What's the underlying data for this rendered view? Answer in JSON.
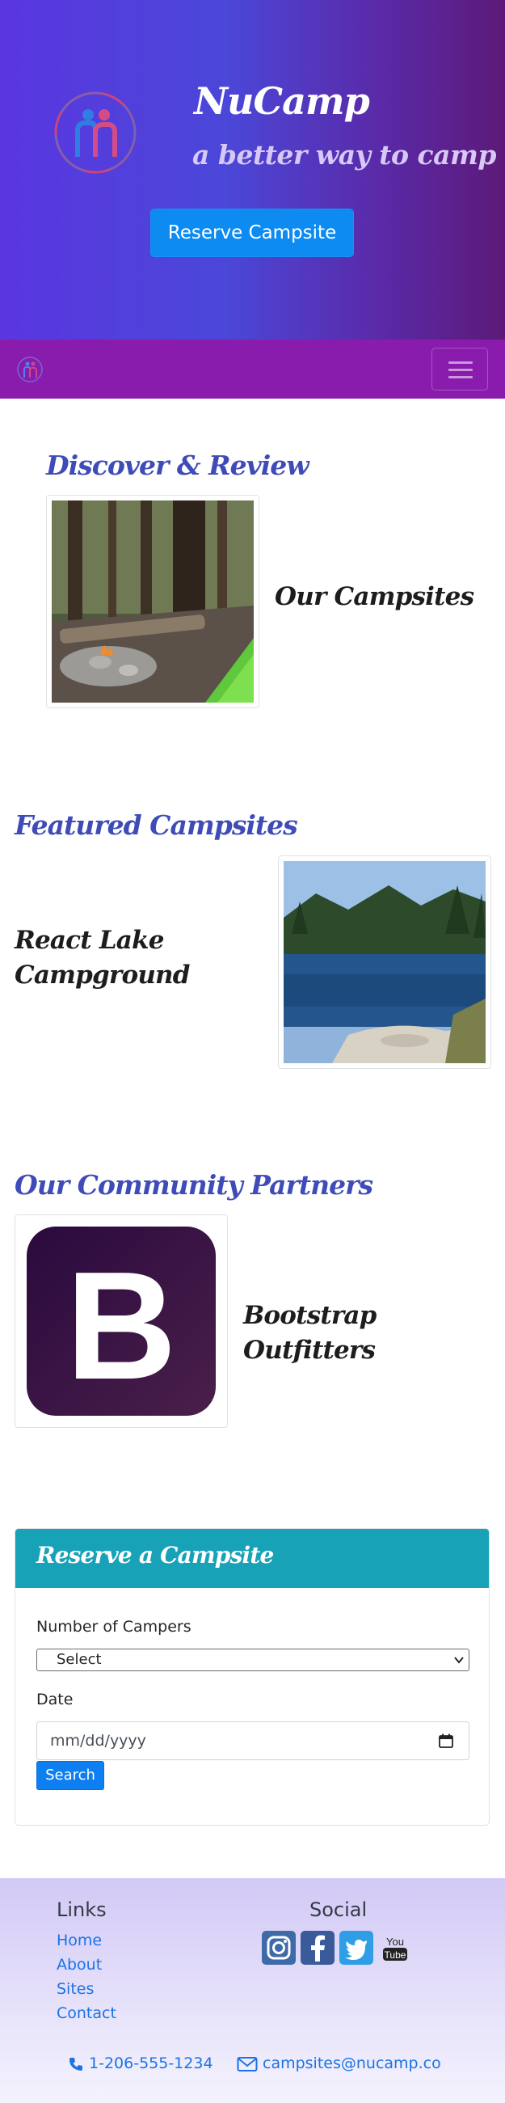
{
  "header": {
    "brand_title": "NuCamp",
    "brand_subtitle": "a better way to camp",
    "reserve_button": "Reserve Campsite"
  },
  "navbar": {
    "toggler_icon": "hamburger-icon"
  },
  "discover": {
    "heading": "Discover & Review",
    "card_title": "Our Campsites"
  },
  "featured": {
    "heading": "Featured Campsites",
    "title_line1": "React Lake",
    "title_line2": "Campground"
  },
  "partners": {
    "heading": "Our Community Partners",
    "card_title": "Bootstrap Outfitters",
    "logo_letter": "B"
  },
  "reservation": {
    "title": "Reserve a Campsite",
    "campers_label": "Number of Campers",
    "campers_selected": "Select",
    "date_label": "Date",
    "date_placeholder": "mm/dd/yyyy",
    "search_button": "Search"
  },
  "footer": {
    "links_heading": "Links",
    "links": [
      "Home",
      "About",
      "Sites",
      "Contact"
    ],
    "social_heading": "Social",
    "social_icons": [
      "instagram-icon",
      "facebook-icon",
      "twitter-icon",
      "youtube-icon"
    ],
    "phone": "1-206-555-1234",
    "email": "campsites@nucamp.co",
    "youtube_line1": "You",
    "youtube_line2": "Tube"
  },
  "colors": {
    "heading_blue": "#3f4cb8",
    "navbar_purple": "#8a1cad",
    "button_blue": "#0d8bf0",
    "card_header_teal": "#17a2b8",
    "link_blue": "#1a73e8"
  }
}
